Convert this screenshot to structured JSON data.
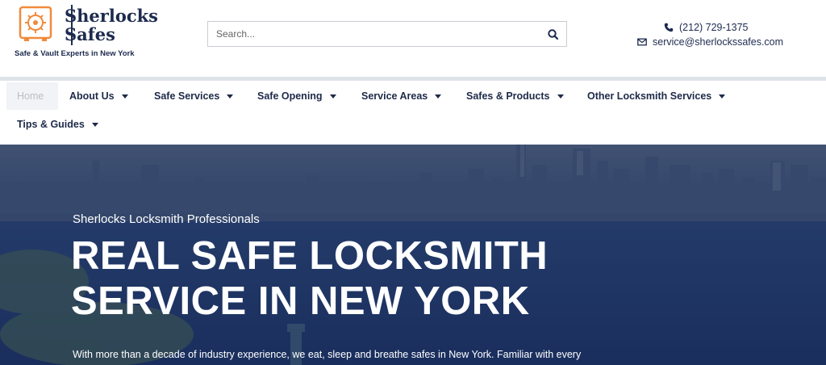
{
  "brand": {
    "name_line1": "Sherlocks",
    "name_line2": "Safes",
    "tagline": "Safe & Vault Experts in New York",
    "colors": {
      "navy": "#1d2b4f",
      "orange": "#f08a3c"
    }
  },
  "search": {
    "placeholder": "Search...",
    "value": ""
  },
  "contact": {
    "phone": "(212) 729-1375",
    "email": "service@sherlockssafes.com",
    "phone_icon": "phone-icon",
    "email_icon": "envelope-icon"
  },
  "nav": {
    "items": [
      {
        "label": "Home",
        "has_dropdown": false,
        "active": true
      },
      {
        "label": "About Us",
        "has_dropdown": true
      },
      {
        "label": "Safe Services",
        "has_dropdown": true
      },
      {
        "label": "Safe Opening",
        "has_dropdown": true
      },
      {
        "label": "Service Areas",
        "has_dropdown": true
      },
      {
        "label": "Safes & Products",
        "has_dropdown": true
      },
      {
        "label": "Other Locksmith Services",
        "has_dropdown": true
      },
      {
        "label": "Tips & Guides",
        "has_dropdown": true
      }
    ]
  },
  "hero": {
    "subtitle": "Sherlocks Locksmith Professionals",
    "title_line1": "REAL SAFE LOCKSMITH",
    "title_line2": "SERVICE IN NEW YORK",
    "body": "With more than a decade of industry experience, we eat, sleep and breathe safes in New York. Familiar with every"
  }
}
